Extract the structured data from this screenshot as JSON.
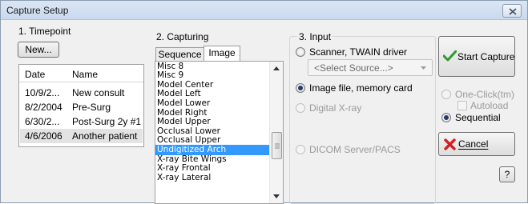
{
  "window": {
    "title": "Capture Setup"
  },
  "timepoint": {
    "title": "1. Timepoint",
    "new_label": "New...",
    "columns": [
      "Date",
      "Name"
    ],
    "rows": [
      {
        "date": "10/9/2...",
        "name": "New consult"
      },
      {
        "date": "8/2/2004",
        "name": "Pre-Surg"
      },
      {
        "date": "6/30/2...",
        "name": "Post-Surg 2y #1"
      },
      {
        "date": "4/6/2006",
        "name": "Another patient"
      }
    ],
    "selected_index": 3
  },
  "capturing": {
    "title": "2. Capturing",
    "tabs": [
      "Sequence",
      "Image"
    ],
    "active_tab": "Image",
    "items": [
      "Misc 8",
      "Misc 9",
      "Model Center",
      "Model Left",
      "Model Lower",
      "Model Right",
      "Model Upper",
      "Occlusal Lower",
      "Occlusal Upper",
      "Undigitized Arch",
      "X-ray Bite Wings",
      "X-ray Frontal",
      "X-ray Lateral"
    ],
    "selected_item": "Undigitized Arch"
  },
  "input": {
    "title": "3. Input",
    "scanner_label": "Scanner, TWAIN driver",
    "select_placeholder": "<Select Source...>",
    "image_file_label": "Image file, memory card",
    "digital_xray_label": "Digital X-ray",
    "dicom_label": "DICOM Server/PACS",
    "selected": "Image file, memory card"
  },
  "actions": {
    "start_capture_label": "Start Capture",
    "one_click_label": "One-Click(tm)",
    "autoload_label": "Autoload",
    "sequential_label": "Sequential",
    "cancel_label": "Cancel",
    "help_label": "?",
    "mode_selected": "Sequential"
  },
  "colors": {
    "selection": "#3399ff",
    "check_green": "#2e9a2e",
    "cancel_red": "#d42020"
  }
}
